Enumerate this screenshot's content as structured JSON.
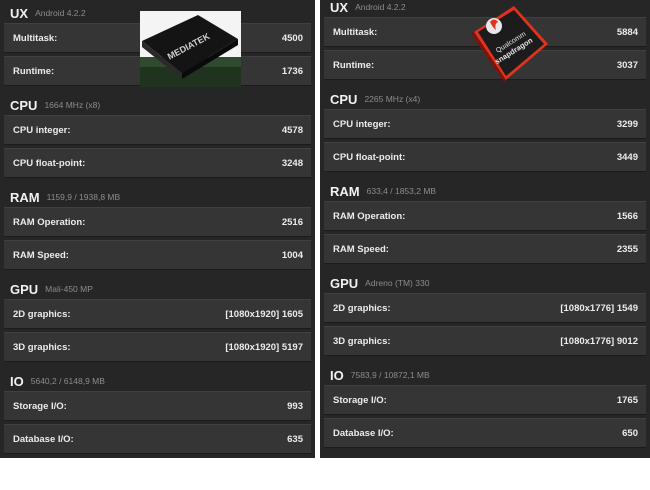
{
  "left": {
    "sections": [
      {
        "title": "UX",
        "subtitle": "Android 4.2.2",
        "rows": [
          {
            "label": "Multitask:",
            "value": "4500"
          },
          {
            "label": "Runtime:",
            "value": "1736"
          }
        ]
      },
      {
        "title": "CPU",
        "subtitle": "1664 MHz (x8)",
        "rows": [
          {
            "label": "CPU integer:",
            "value": "4578"
          },
          {
            "label": "CPU float-point:",
            "value": "3248"
          }
        ]
      },
      {
        "title": "RAM",
        "subtitle": "1159,9 / 1938,8 MB",
        "rows": [
          {
            "label": "RAM Operation:",
            "value": "2516"
          },
          {
            "label": "RAM Speed:",
            "value": "1004"
          }
        ]
      },
      {
        "title": "GPU",
        "subtitle": "Mali-450 MP",
        "rows": [
          {
            "label": "2D graphics:",
            "value": "[1080x1920] 1605"
          },
          {
            "label": "3D graphics:",
            "value": "[1080x1920] 5197"
          }
        ]
      },
      {
        "title": "IO",
        "subtitle": "5640,2 / 6148,9 MB",
        "rows": [
          {
            "label": "Storage I/O:",
            "value": "993"
          },
          {
            "label": "Database I/O:",
            "value": "635"
          }
        ]
      }
    ],
    "logo": {
      "text": "MEDIATEK",
      "icon": "mediatek-chip-icon"
    }
  },
  "right": {
    "sections": [
      {
        "title": "UX",
        "subtitle": "Android 4.2.2",
        "rows": [
          {
            "label": "Multitask:",
            "value": "5884"
          },
          {
            "label": "Runtime:",
            "value": "3037"
          }
        ]
      },
      {
        "title": "CPU",
        "subtitle": "2265 MHz (x4)",
        "rows": [
          {
            "label": "CPU integer:",
            "value": "3299"
          },
          {
            "label": "CPU float-point:",
            "value": "3449"
          }
        ]
      },
      {
        "title": "RAM",
        "subtitle": "633,4 / 1853,2 MB",
        "rows": [
          {
            "label": "RAM Operation:",
            "value": "1566"
          },
          {
            "label": "RAM Speed:",
            "value": "2355"
          }
        ]
      },
      {
        "title": "GPU",
        "subtitle": "Adreno (TM) 330",
        "rows": [
          {
            "label": "2D graphics:",
            "value": "[1080x1776] 1549"
          },
          {
            "label": "3D graphics:",
            "value": "[1080x1776] 9012"
          }
        ]
      },
      {
        "title": "IO",
        "subtitle": "7583,9 / 10872,1 MB",
        "rows": [
          {
            "label": "Storage I/O:",
            "value": "1765"
          },
          {
            "label": "Database I/O:",
            "value": "650"
          }
        ]
      }
    ],
    "logo": {
      "text_top": "Qualcomm",
      "text_bottom": "snapdragon",
      "icon": "snapdragon-chip-icon"
    }
  }
}
